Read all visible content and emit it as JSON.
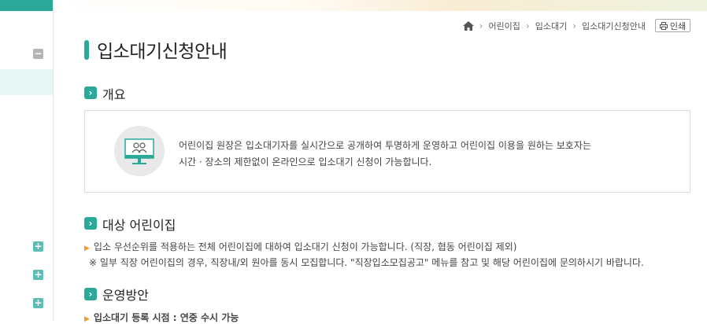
{
  "breadcrumb": {
    "items": [
      "어린이집",
      "입소대기",
      "입소대기신청안내"
    ],
    "print_label": "인쇄"
  },
  "page": {
    "title": "입소대기신청안내"
  },
  "sections": [
    {
      "title": "개요"
    },
    {
      "title": "대상 어린이집"
    },
    {
      "title": "운영방안"
    }
  ],
  "overview": {
    "line1": "어린이집 원장은 입소대기자를 실시간으로 공개하여 투명하게 운영하고 어린이집 이용을 원하는 보호자는",
    "line2": "시간 · 장소의 제한없이 온라인으로 입소대기 신청이 가능합니다."
  },
  "target": {
    "bullet": "입소 우선순위를 적용하는 전체 어린이집에 대하여 입소대기 신청이 가능합니다. (직장, 협동 어린이집 제외)",
    "note": "※ 일부 직장 어린이집의 경우, 직장내/외 원아를 동시 모집합니다. \"직장입소모집공고\" 메뉴를 참고 및 해당 어린이집에 문의하시기 바랍니다."
  },
  "operation": {
    "bullet": "입소대기 등록 시점 : 연중 수시 가능"
  },
  "colors": {
    "accent": "#2aa898",
    "bullet": "#f29d1f"
  }
}
